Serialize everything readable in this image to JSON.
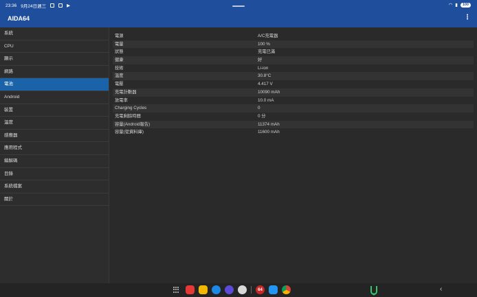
{
  "status": {
    "time": "23:36",
    "date": "9月24日週三",
    "battery": "100"
  },
  "app": {
    "title": "AIDA64",
    "menu_glyph": "⋮"
  },
  "sidebar": {
    "items": [
      {
        "label": "系統"
      },
      {
        "label": "CPU"
      },
      {
        "label": "顯示"
      },
      {
        "label": "網路"
      },
      {
        "label": "電池",
        "active": true
      },
      {
        "label": "Android"
      },
      {
        "label": "裝置"
      },
      {
        "label": "溫度"
      },
      {
        "label": "感應器"
      },
      {
        "label": "應用程式"
      },
      {
        "label": "編解碼"
      },
      {
        "label": "目錄"
      },
      {
        "label": "系統檔案"
      },
      {
        "label": "關於"
      }
    ]
  },
  "battery_info": {
    "rows": [
      {
        "key": "電源",
        "value": "A/C充電器"
      },
      {
        "key": "電量",
        "value": "100 %"
      },
      {
        "key": "狀態",
        "value": "充電已滿"
      },
      {
        "key": "健康",
        "value": "好"
      },
      {
        "key": "技術",
        "value": "Li-ion"
      },
      {
        "key": "溫度",
        "value": "30.8°C"
      },
      {
        "key": "電壓",
        "value": "4.417 V"
      },
      {
        "key": "充電計數器",
        "value": "10090 mAh"
      },
      {
        "key": "放電率",
        "value": "10.0 mA"
      },
      {
        "key": "Charging Cycles",
        "value": "0"
      },
      {
        "key": "充電剩餘時間",
        "value": "0 分"
      },
      {
        "key": "容量(Android報告)",
        "value": "11374 mAh"
      },
      {
        "key": "容量(從資料庫)",
        "value": "11600 mAh"
      }
    ]
  },
  "dock": {
    "apps": [
      {
        "name": "flipboard-icon",
        "color": "#e53935",
        "label": ""
      },
      {
        "name": "notes-icon",
        "color": "#f5b800",
        "label": ""
      },
      {
        "name": "messages-icon",
        "color": "#1e88e5",
        "label": ""
      },
      {
        "name": "cloud-icon",
        "color": "#5b4bd6",
        "label": ""
      },
      {
        "name": "camera-icon",
        "color": "#d9d9d9",
        "label": ""
      },
      {
        "name": "aida64-icon",
        "color": "#c62828",
        "label": "64"
      },
      {
        "name": "maps-icon",
        "color": "#2196f3",
        "label": ""
      },
      {
        "name": "chrome-icon",
        "color": "#f4f4f4",
        "label": ""
      }
    ],
    "back_glyph": "‹"
  }
}
